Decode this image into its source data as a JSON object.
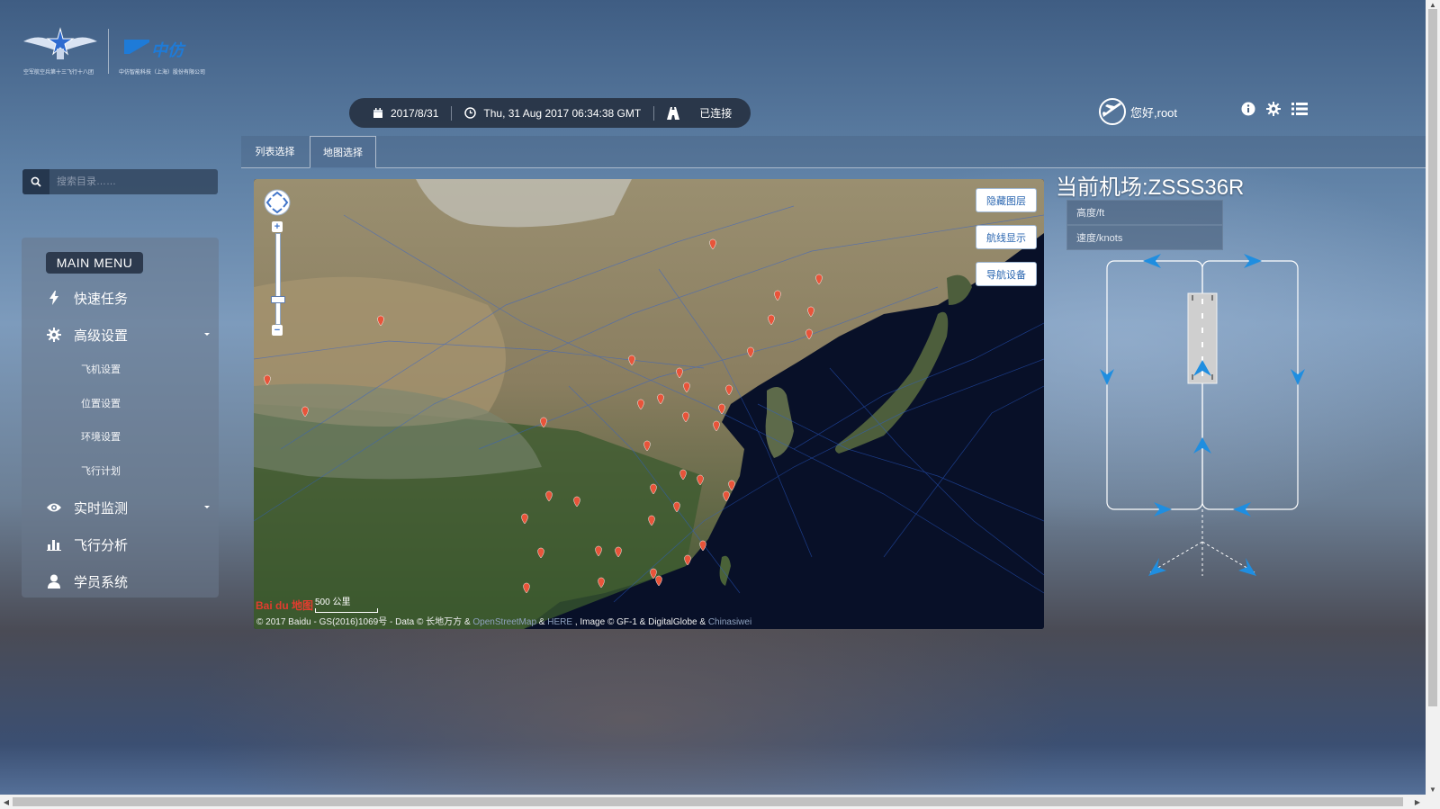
{
  "logo": {
    "left_caption": "空军航空兵第十三飞行十八团",
    "brand_name": "中仿",
    "right_caption": "中仿智能科技（上海）股份有限公司"
  },
  "status_bar": {
    "date": "2017/8/31",
    "time": "Thu, 31 Aug 2017 06:34:38 GMT",
    "connection": "已连接"
  },
  "user": {
    "greeting": "您好,root"
  },
  "search": {
    "placeholder": "搜索目录……"
  },
  "menu": {
    "title": "MAIN MENU",
    "items": [
      {
        "label": "快速任务",
        "icon": "bolt-icon"
      },
      {
        "label": "高级设置",
        "icon": "gear-icon",
        "subitems": [
          "飞机设置",
          "位置设置",
          "环境设置",
          "飞行计划"
        ]
      },
      {
        "label": "实时监测",
        "icon": "eye-icon"
      },
      {
        "label": "飞行分析",
        "icon": "bar-chart-icon"
      },
      {
        "label": "学员系统",
        "icon": "user-icon"
      }
    ]
  },
  "tabs": [
    {
      "label": "列表选择",
      "active": false
    },
    {
      "label": "地图选择",
      "active": true
    }
  ],
  "map": {
    "buttons": [
      "隐藏图层",
      "航线显示",
      "导航设备"
    ],
    "scale_label": "500 公里",
    "baidu_logo": "Bai du 地图",
    "copyright_prefix": "© 2017 Baidu - GS(2016)1069号 - Data © 长地万方 & ",
    "copyright_osm": "OpenStreetMap",
    "copyright_amp": " & ",
    "copyright_here": "HERE",
    "copyright_mid": " , Image © GF-1 & DigitalGlobe & ",
    "copyright_chinasiwei": "Chinasiwei",
    "zoom_in": "+",
    "zoom_out": "−"
  },
  "airport_panel": {
    "title": "当前机场:ZSSS36R",
    "altitude_placeholder": "高度/ft",
    "speed_placeholder": "速度/knots"
  },
  "colors": {
    "accent_blue": "#1f8ee0",
    "marker_red": "#e8543a",
    "map_ocean": "#081028"
  }
}
